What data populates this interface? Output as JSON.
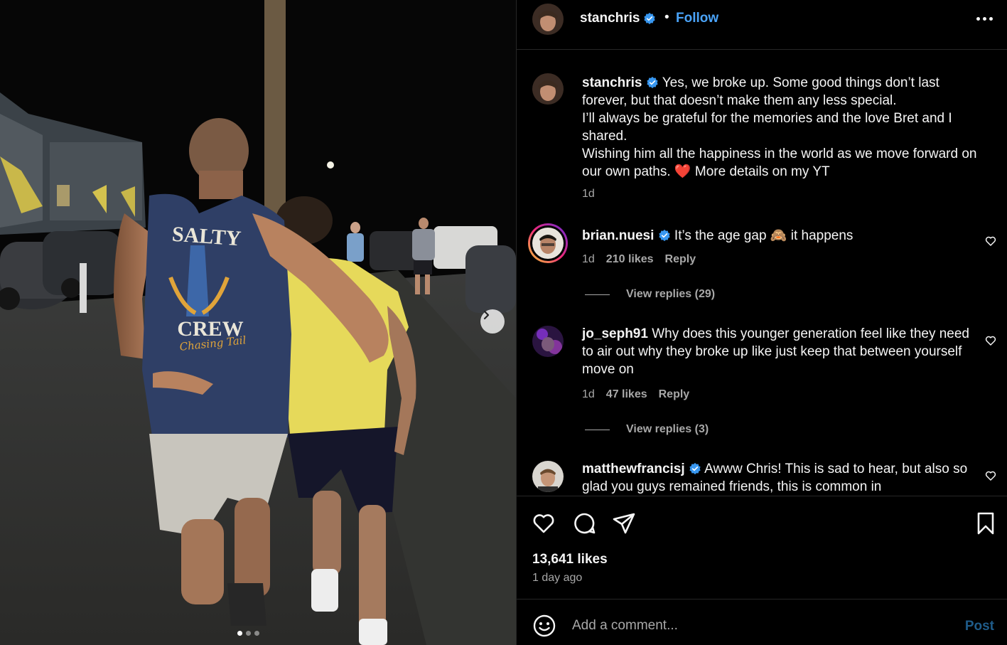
{
  "photo": {
    "shirt_text_top": "SALTY",
    "shirt_text_mid": "CREW",
    "shirt_text_script": "Chasing Tail",
    "carousel_count": 3,
    "carousel_active": 1
  },
  "header": {
    "username": "stanchris",
    "separator": "•",
    "follow_label": "Follow"
  },
  "caption": {
    "username": "stanchris",
    "text_line1": "Yes, we broke up. Some good things don’t last forever, but that doesn’t make them any less special.",
    "text_line2": "I’ll always be grateful for the memories and the love Bret and I shared.",
    "text_line3_a": "Wishing him all the happiness in the world as we move forward on our own paths.",
    "text_line3_emoji": "❤️",
    "text_line3_b": "More details on my YT",
    "time": "1d"
  },
  "comments": [
    {
      "username": "brian.nuesi",
      "verified": true,
      "text_a": "It’s the age gap",
      "emoji": "🙈",
      "text_b": "it happens",
      "time": "1d",
      "likes": "210 likes",
      "reply_label": "Reply",
      "view_replies": "View replies (29)"
    },
    {
      "username": "jo_seph91",
      "verified": false,
      "text": "Why does this younger generation feel like they need to air out why they broke up like just keep that between yourself move on",
      "time": "1d",
      "likes": "47 likes",
      "reply_label": "Reply",
      "view_replies": "View replies (3)"
    },
    {
      "username": "matthewfrancisj",
      "verified": true,
      "text": "Awww Chris! This is sad to hear, but also so glad you guys remained friends, this is common in"
    }
  ],
  "stats": {
    "likes": "13,641 likes",
    "time_ago": "1 day ago"
  },
  "composer": {
    "placeholder": "Add a comment...",
    "post_label": "Post"
  },
  "colors": {
    "background": "#000000",
    "link_blue": "#4aa3f8",
    "verified_blue": "#3897f0",
    "muted_text": "#a8a8a8",
    "post_disabled": "#1f5c8a"
  },
  "icons": {
    "header_more": "more-horizontal-icon",
    "carousel_next": "chevron-right-icon",
    "like": "heart-icon",
    "comment": "comment-bubble-icon",
    "share": "paper-plane-icon",
    "save": "bookmark-icon",
    "emoji": "smiley-icon",
    "verified": "verified-badge-icon"
  }
}
